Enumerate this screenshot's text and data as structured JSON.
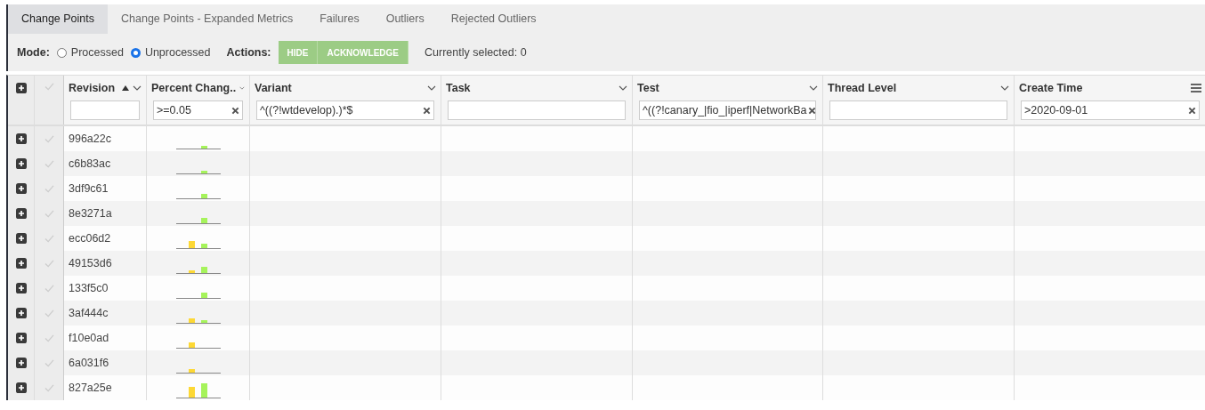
{
  "tabs": [
    {
      "label": "Change Points",
      "selected": true
    },
    {
      "label": "Change Points - Expanded Metrics",
      "selected": false
    },
    {
      "label": "Failures",
      "selected": false
    },
    {
      "label": "Outliers",
      "selected": false
    },
    {
      "label": "Rejected Outliers",
      "selected": false
    }
  ],
  "mode": {
    "label": "Mode:",
    "options": [
      {
        "label": "Processed",
        "selected": false
      },
      {
        "label": "Unprocessed",
        "selected": true
      }
    ]
  },
  "actions": {
    "label": "Actions:",
    "buttons": [
      "HIDE",
      "ACKNOWLEDGE"
    ]
  },
  "selection_count": "Currently selected: 0",
  "table": {
    "columns": [
      {
        "label": "Revision",
        "sorted": true
      },
      {
        "label": "Percent Chang..",
        "sorted": false,
        "filter": ">=0.05"
      },
      {
        "label": "Variant",
        "sorted": false,
        "filter": "^((?!wtdevelop).)*$"
      },
      {
        "label": "Task",
        "sorted": false
      },
      {
        "label": "Test",
        "sorted": false,
        "filter": "^((?!canary_|fio_|iperf|NetworkBa"
      },
      {
        "label": "Thread Level",
        "sorted": false
      },
      {
        "label": "Create Time",
        "sorted": false,
        "filter": ">2020-09-01"
      }
    ],
    "rows": [
      {
        "revision": "996a22c"
      },
      {
        "revision": "c6b83ac"
      },
      {
        "revision": "3df9c61"
      },
      {
        "revision": "8e3271a"
      },
      {
        "revision": "ecc06d2"
      },
      {
        "revision": "49153d6"
      },
      {
        "revision": "133f5c0"
      },
      {
        "revision": "3af444c"
      },
      {
        "revision": "f10e0ad"
      },
      {
        "revision": "6a031f6"
      },
      {
        "revision": "827a25e"
      }
    ]
  }
}
